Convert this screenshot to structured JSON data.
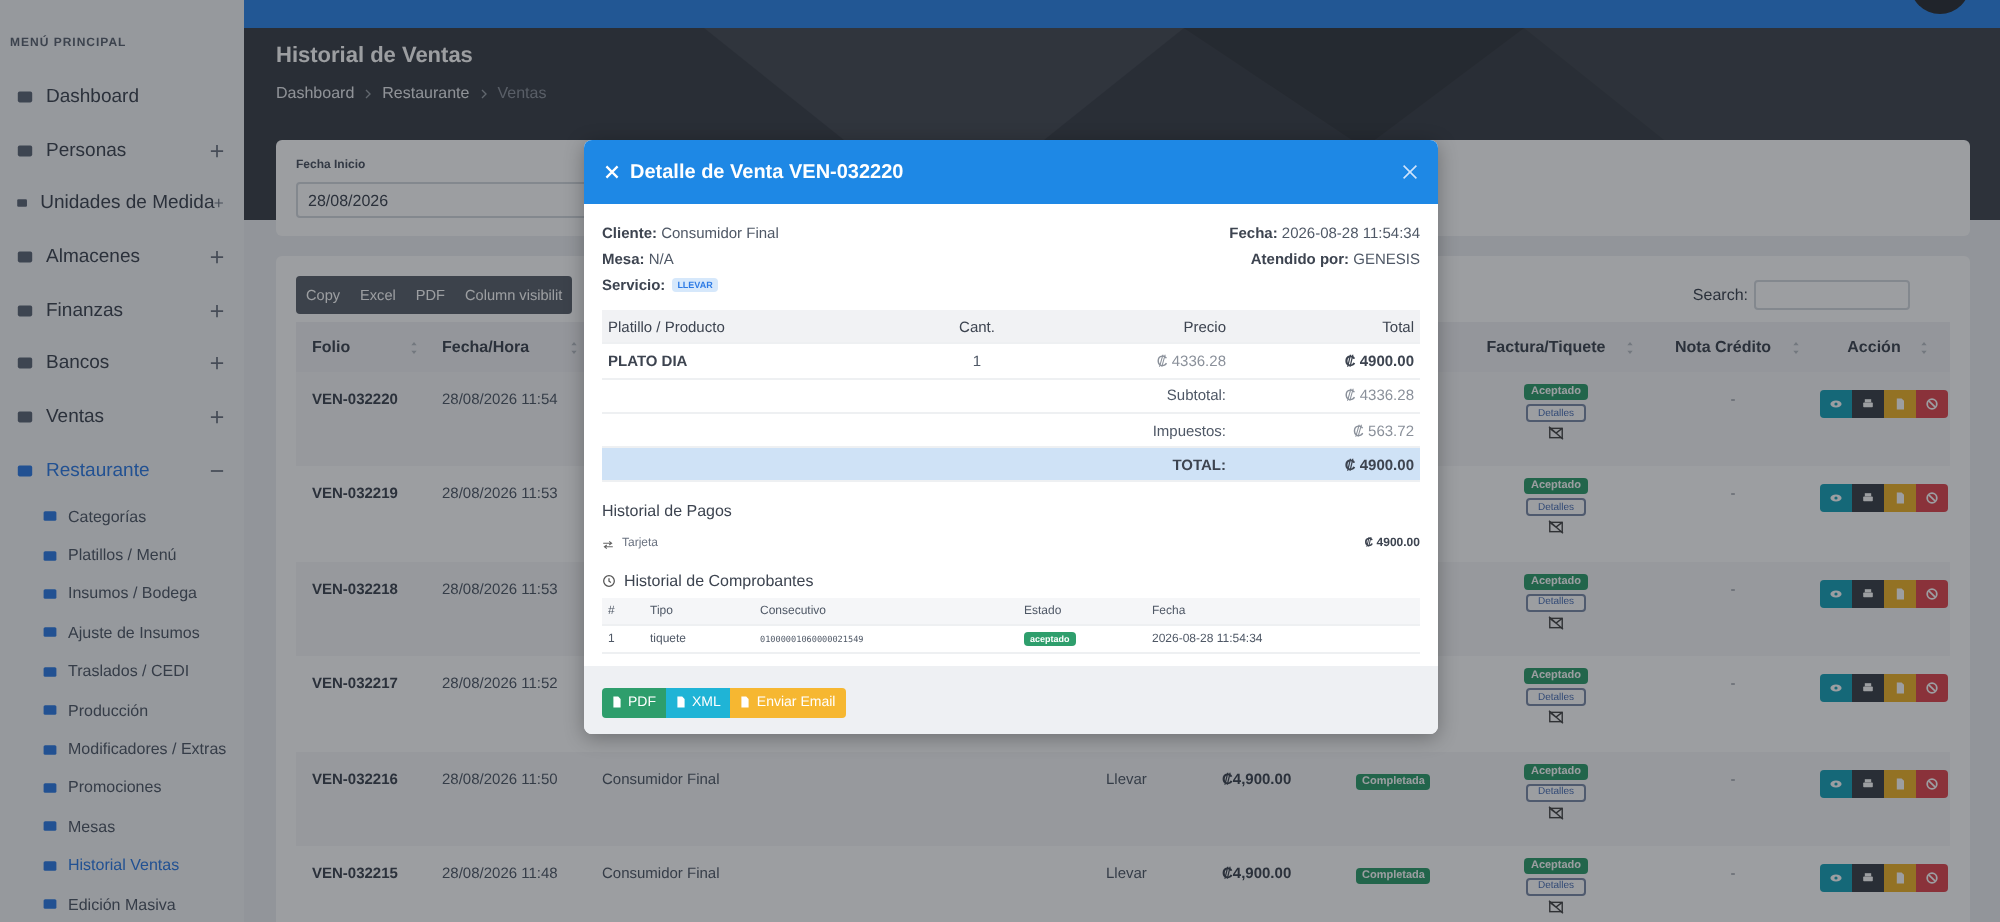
{
  "sidebar": {
    "heading": "MENÚ PRINCIPAL",
    "items": [
      {
        "label": "Dashboard",
        "selected": false
      },
      {
        "label": "Personas",
        "selected": false,
        "expanded": false
      },
      {
        "label": "Unidades de Medida",
        "selected": false,
        "expanded": false
      },
      {
        "label": "Almacenes",
        "selected": false,
        "expanded": false
      },
      {
        "label": "Finanzas",
        "selected": false,
        "expanded": false
      },
      {
        "label": "Bancos",
        "selected": false,
        "expanded": false
      },
      {
        "label": "Ventas",
        "selected": false,
        "expanded": false
      },
      {
        "label": "Restaurante",
        "selected": true,
        "expanded": true,
        "children": [
          {
            "label": "Categorías",
            "selected": false
          },
          {
            "label": "Platillos / Menú",
            "selected": false
          },
          {
            "label": "Insumos / Bodega",
            "selected": false
          },
          {
            "label": "Ajuste de Insumos",
            "selected": false
          },
          {
            "label": "Traslados / CEDI",
            "selected": false
          },
          {
            "label": "Producción",
            "selected": false
          },
          {
            "label": "Modificadores / Extras",
            "selected": false
          },
          {
            "label": "Promociones",
            "selected": false
          },
          {
            "label": "Mesas",
            "selected": false
          },
          {
            "label": "Historial Ventas",
            "selected": true
          },
          {
            "label": "Edición Masiva",
            "selected": false
          }
        ]
      }
    ]
  },
  "page": {
    "title": "Historial de Ventas",
    "breadcrumb": [
      {
        "label": "Dashboard",
        "current": false
      },
      {
        "label": "Restaurante",
        "current": false
      },
      {
        "label": "Ventas",
        "current": true
      }
    ]
  },
  "filter": {
    "label": "Fecha Inicio",
    "value": "28/08/2026"
  },
  "toolbar": {
    "buttons": [
      "Copy",
      "Excel",
      "PDF",
      "Column visibilit"
    ],
    "search_label": "Search:"
  },
  "table": {
    "columns_left": [
      "Folio",
      "Fecha/Hora"
    ],
    "columns_right": [
      "Factura/Tiquete",
      "Nota Crédito",
      "Acción"
    ],
    "rows": [
      {
        "folio": "VEN-032220",
        "datetime": "28/08/2026 11:54",
        "invoice_status": "Aceptado",
        "details": "Detalles",
        "credit_note": "-"
      },
      {
        "folio": "VEN-032219",
        "datetime": "28/08/2026 11:53",
        "invoice_status": "Aceptado",
        "details": "Detalles",
        "credit_note": "-"
      },
      {
        "folio": "VEN-032218",
        "datetime": "28/08/2026 11:53",
        "invoice_status": "Aceptado",
        "details": "Detalles",
        "credit_note": "-"
      },
      {
        "folio": "VEN-032217",
        "datetime": "28/08/2026 11:52",
        "invoice_status": "Aceptado",
        "details": "Detalles",
        "credit_note": "-"
      },
      {
        "folio": "VEN-032216",
        "datetime": "28/08/2026 11:50",
        "client": "Consumidor Final",
        "service": "Llevar",
        "total": "₡4,900.00",
        "status": "Completada",
        "invoice_status": "Aceptado",
        "details": "Detalles",
        "credit_note": "-"
      },
      {
        "folio": "VEN-032215",
        "datetime": "28/08/2026 11:48",
        "client": "Consumidor Final",
        "service": "Llevar",
        "total": "₡4,900.00",
        "status": "Completada",
        "invoice_status": "Aceptado",
        "details": "Detalles",
        "credit_note": "-"
      }
    ]
  },
  "modal": {
    "title": "Detalle de Venta VEN-032220",
    "info_left": [
      {
        "label": "Cliente:",
        "value": "Consumidor Final"
      },
      {
        "label": "Mesa:",
        "value": "N/A"
      },
      {
        "label": "Servicio:",
        "badge": "LLEVAR"
      }
    ],
    "info_right": [
      {
        "label": "Fecha:",
        "value": "2026-08-28 11:54:34"
      },
      {
        "label": "Atendido por:",
        "value": "GENESIS"
      }
    ],
    "items_table": {
      "columns": [
        "Platillo / Producto",
        "Cant.",
        "Precio",
        "Total"
      ],
      "rows": [
        {
          "product": "PLATO DIA",
          "qty": "1",
          "price": "₡ 4336.28",
          "total": "₡ 4900.00"
        }
      ],
      "summary": [
        {
          "label": "Subtotal:",
          "value": "₡ 4336.28",
          "kind": "normal"
        },
        {
          "label": "Impuestos:",
          "value": "₡ 563.72",
          "kind": "normal"
        },
        {
          "label": "TOTAL:",
          "value": "₡ 4900.00",
          "kind": "grand"
        }
      ]
    },
    "payments": {
      "title": "Historial de Pagos",
      "rows": [
        {
          "method": "Tarjeta",
          "amount": "₡ 4900.00"
        }
      ]
    },
    "receipts": {
      "title": "Historial de Comprobantes",
      "columns": [
        "#",
        "Tipo",
        "Consecutivo",
        "Estado",
        "Fecha"
      ],
      "rows": [
        {
          "number": "1",
          "type": "tiquete",
          "consecutive": "01000001060000021549",
          "status": "aceptado",
          "date": "2026-08-28 11:54:34"
        }
      ]
    },
    "buttons": [
      {
        "label": "PDF",
        "kind": "pdf"
      },
      {
        "label": "XML",
        "kind": "xml"
      },
      {
        "label": "Enviar Email",
        "kind": "email"
      }
    ]
  }
}
